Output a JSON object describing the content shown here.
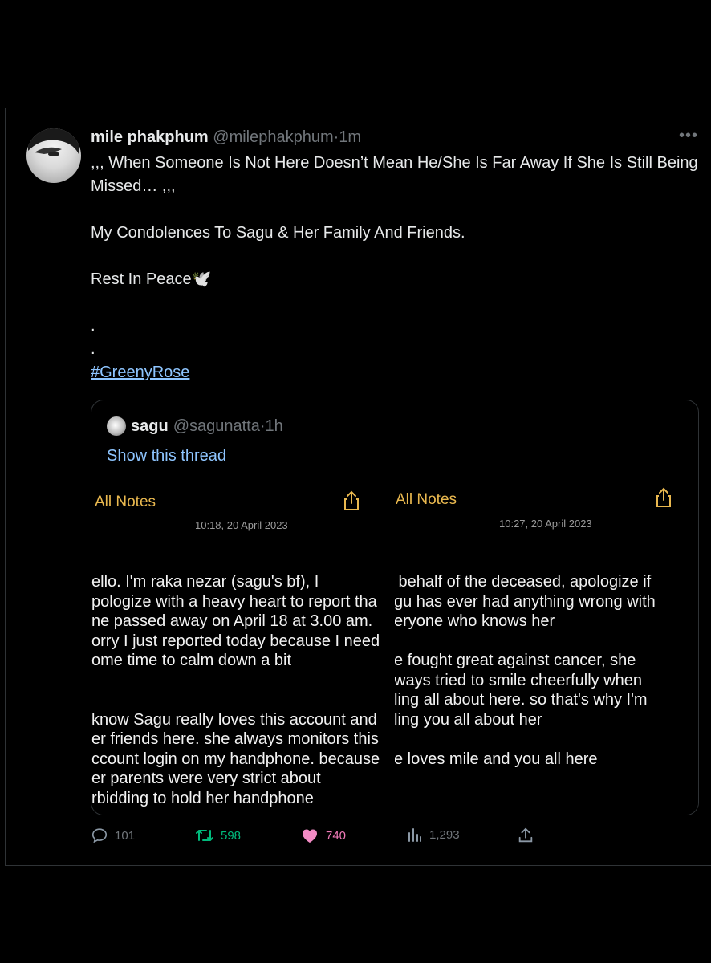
{
  "tweet": {
    "display_name": "mile phakphum",
    "handle": "@milephakphum",
    "separator": "·",
    "time": "1m",
    "more_icon": "more-horizontal-icon",
    "text_lines": [
      ",,, When Someone Is Not Here Doesn’t Mean He/She Is Far Away If She Is Still Being Missed… ,,,",
      "My Condolences To Sagu & Her Family And Friends.",
      "Rest In Peace🕊️",
      ".",
      "."
    ],
    "hashtag": "#GreenyRose"
  },
  "quote": {
    "display_name": "sagu",
    "handle": "@sagunatta",
    "separator": "·",
    "time": "1h",
    "show_thread": "Show this thread",
    "notes": [
      {
        "back_label": "All Notes",
        "date": "10:18, 20 April 2023",
        "body": "ello. I'm raka nezar (sagu's bf), I\npologize with a heavy heart to report tha\nne passed away on April 18 at 3.00 am.\norry I just reported today because I need\nome time to calm down a bit\n\n\nknow Sagu really loves this account and\ner friends here. she always monitors this\nccount login on my handphone. because\ner parents were very strict about\nrbidding to hold her handphone"
      },
      {
        "back_label": "All Notes",
        "back_prefix": "(··",
        "date": "10:27, 20 April 2023",
        "body": " behalf of the deceased, apologize if\ngu has ever had anything wrong with\neryone who knows her\n\ne fought great against cancer, she\nways tried to smile cheerfully when\nling all about here. so that's why I'm\nling you all about her\n\ne loves mile and you all here"
      }
    ]
  },
  "actions": {
    "replies": "101",
    "retweets": "598",
    "likes": "740",
    "views": "1,293",
    "icons": [
      "reply-icon",
      "retweet-icon",
      "heart-icon",
      "views-icon",
      "share-icon"
    ],
    "colors": {
      "reply": "#71767b",
      "retweet": "#00ba7c",
      "like": "#f91880"
    }
  }
}
